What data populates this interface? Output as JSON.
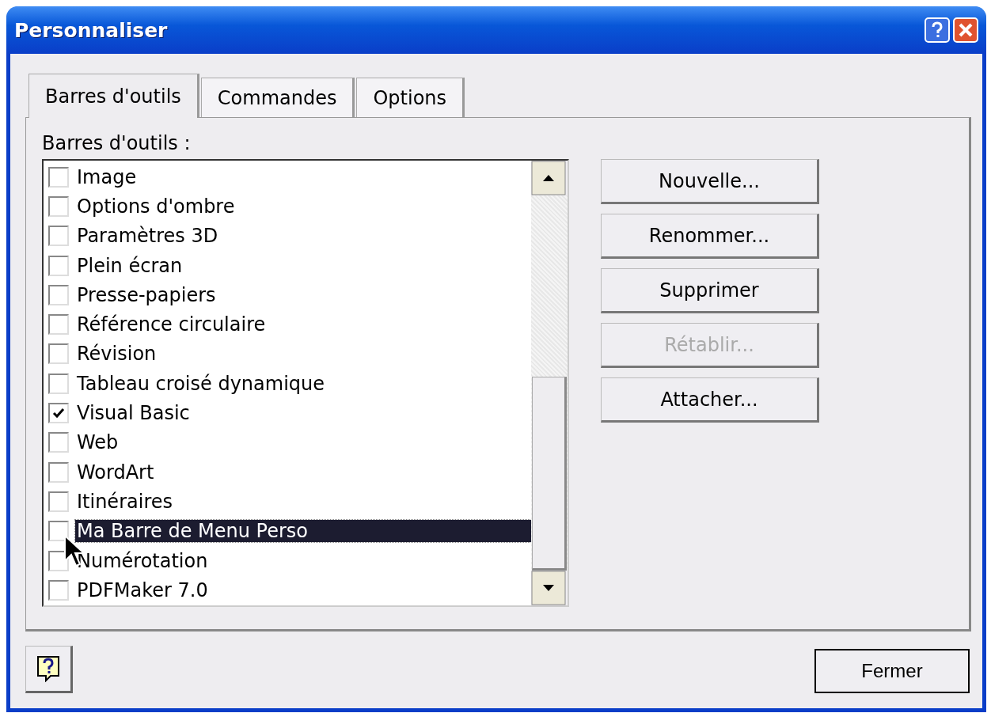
{
  "window": {
    "title": "Personnaliser"
  },
  "tabs": [
    {
      "label": "Barres d'outils",
      "selected": true
    },
    {
      "label": "Commandes",
      "selected": false
    },
    {
      "label": "Options",
      "selected": false
    }
  ],
  "list_label": "Barres d'outils :",
  "toolbars": [
    {
      "label": "Image",
      "checked": false,
      "selected": false
    },
    {
      "label": "Options d'ombre",
      "checked": false,
      "selected": false
    },
    {
      "label": "Paramètres 3D",
      "checked": false,
      "selected": false
    },
    {
      "label": "Plein écran",
      "checked": false,
      "selected": false
    },
    {
      "label": "Presse-papiers",
      "checked": false,
      "selected": false
    },
    {
      "label": "Référence circulaire",
      "checked": false,
      "selected": false
    },
    {
      "label": "Révision",
      "checked": false,
      "selected": false
    },
    {
      "label": "Tableau croisé dynamique",
      "checked": false,
      "selected": false
    },
    {
      "label": "Visual Basic",
      "checked": true,
      "selected": false
    },
    {
      "label": "Web",
      "checked": false,
      "selected": false
    },
    {
      "label": "WordArt",
      "checked": false,
      "selected": false
    },
    {
      "label": "Itinéraires",
      "checked": false,
      "selected": false
    },
    {
      "label": "Ma Barre de Menu Perso",
      "checked": false,
      "selected": true
    },
    {
      "label": "Numérotation",
      "checked": false,
      "selected": false
    },
    {
      "label": "PDFMaker 7.0",
      "checked": false,
      "selected": false
    }
  ],
  "buttons": [
    {
      "label": "Nouvelle...",
      "disabled": false
    },
    {
      "label": "Renommer...",
      "disabled": false
    },
    {
      "label": "Supprimer",
      "disabled": false
    },
    {
      "label": "Rétablir...",
      "disabled": true
    },
    {
      "label": "Attacher...",
      "disabled": false
    }
  ],
  "close_button": "Fermer"
}
